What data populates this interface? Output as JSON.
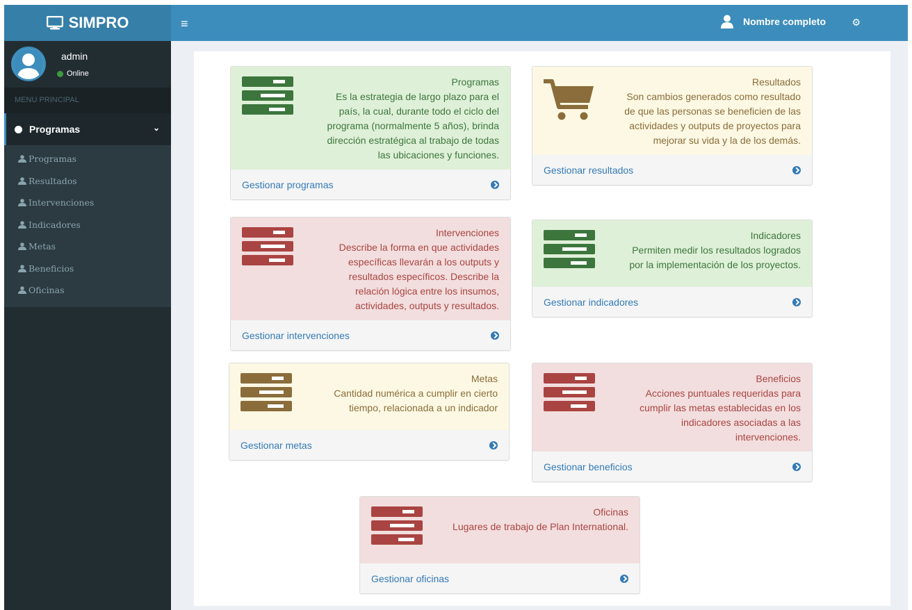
{
  "header": {
    "brand": "SIMPRO",
    "user_name": "Nombre completo"
  },
  "sidebar": {
    "user": {
      "name": "admin",
      "status": "Online"
    },
    "menu_header": "MENU PRINCIPAL",
    "main_item": "Programas",
    "items": [
      {
        "label": "Programas"
      },
      {
        "label": "Resultados"
      },
      {
        "label": "Intervenciones"
      },
      {
        "label": "Indicadores"
      },
      {
        "label": "Metas"
      },
      {
        "label": "Beneficios"
      },
      {
        "label": "Oficinas"
      }
    ]
  },
  "cards": {
    "programas": {
      "title": "Programas",
      "lines": [
        "Es la estrategia de largo plazo para el",
        "país, la cual, durante todo el ciclo del",
        "programa (normalmente 5 años), brinda",
        "dirección estratégica al trabajo de todas",
        "las ubicaciones y funciones."
      ],
      "link": "Gestionar programas"
    },
    "resultados": {
      "title": "Resultados",
      "lines": [
        "Son cambios generados como resultado",
        "de que las personas se beneficien de las",
        "actividades y outputs de proyectos para",
        "mejorar su vida y la de los demás."
      ],
      "link": "Gestionar resultados"
    },
    "intervenciones": {
      "title": "Intervenciones",
      "lines": [
        "Describe la forma en que actividades",
        "específicas llevarán a los outputs y",
        "resultados específicos. Describe la",
        "relación lógica entre los insumos,",
        "actividades, outputs y resultados."
      ],
      "link": "Gestionar intervenciones"
    },
    "indicadores": {
      "title": "Indicadores",
      "lines": [
        "Permiten medir los resultados logrados",
        "por la implementación de los proyectos."
      ],
      "link": "Gestionar indicadores"
    },
    "metas": {
      "title": "Metas",
      "lines": [
        "Cantidad numérica a cumplir en cierto",
        "tiempo, relacionada a un indicador"
      ],
      "link": "Gestionar metas"
    },
    "beneficios": {
      "title": "Beneficios",
      "lines": [
        "Acciones puntuales requeridas para",
        "cumplir las metas establecidas en los",
        "indicadores asociadas a las",
        "intervenciones."
      ],
      "link": "Gestionar beneficios"
    },
    "oficinas": {
      "title": "Oficinas",
      "lines": [
        "Lugares de trabajo de Plan International."
      ],
      "link": "Gestionar oficinas"
    }
  },
  "colors": {
    "header": "#3c8dbc",
    "logo": "#367fa9",
    "sidebar": "#222d32",
    "success": "#dff0d8",
    "warning": "#fcf8e3",
    "danger": "#f2dede",
    "link": "#337ab7"
  }
}
